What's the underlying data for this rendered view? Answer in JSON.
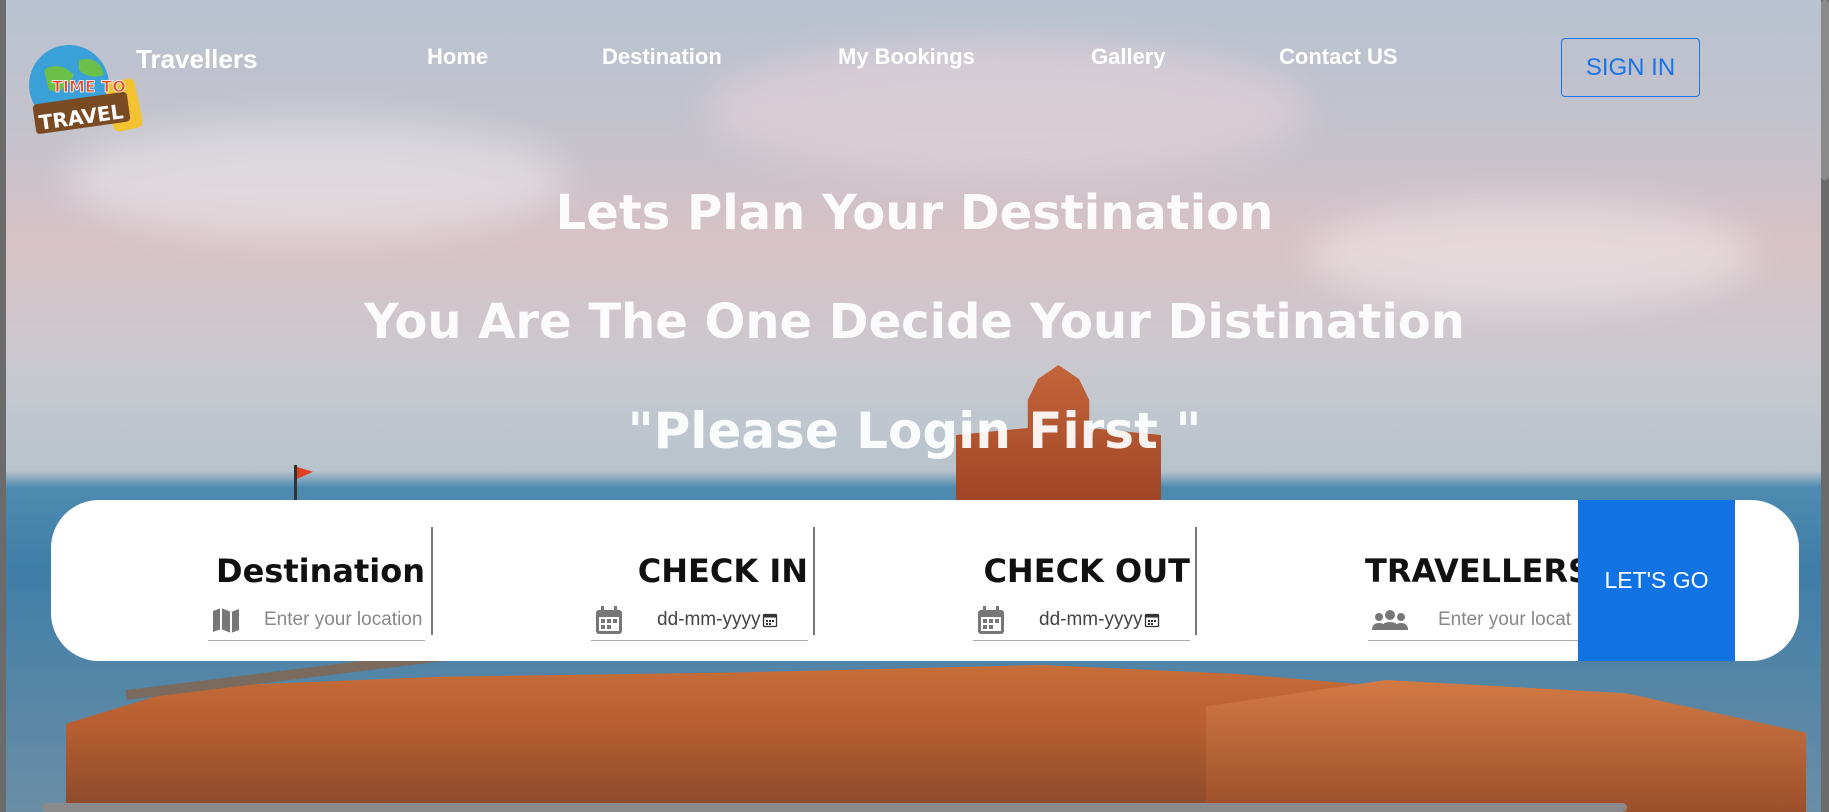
{
  "brand": {
    "name": "Travellers",
    "logo_text": [
      "TIME TO",
      "TRAVEL"
    ]
  },
  "nav": {
    "items": [
      {
        "label": "Home"
      },
      {
        "label": "Destination"
      },
      {
        "label": "My Bookings"
      },
      {
        "label": "Gallery"
      },
      {
        "label": "Contact US"
      }
    ],
    "signin_label": "SIGN IN"
  },
  "hero": {
    "line1": "Lets Plan Your Destination",
    "line2": "You Are The One Decide Your Distination",
    "line3": "\"Please Login First \""
  },
  "search": {
    "destination": {
      "label": "Destination",
      "placeholder": "Enter your location",
      "icon": "map-icon"
    },
    "checkin": {
      "label": "CHECK IN",
      "value": "dd-mm-yyyy",
      "icon": "calendar-icon"
    },
    "checkout": {
      "label": "CHECK OUT",
      "value": "dd-mm-yyyy",
      "icon": "calendar-icon"
    },
    "travellers": {
      "label": "TRAVELLERS",
      "placeholder": "Enter your locat",
      "icon": "users-icon"
    },
    "go_label": "LET'S GO"
  },
  "colors": {
    "accent": "#1172e3",
    "signin_border": "#1a73e8"
  }
}
